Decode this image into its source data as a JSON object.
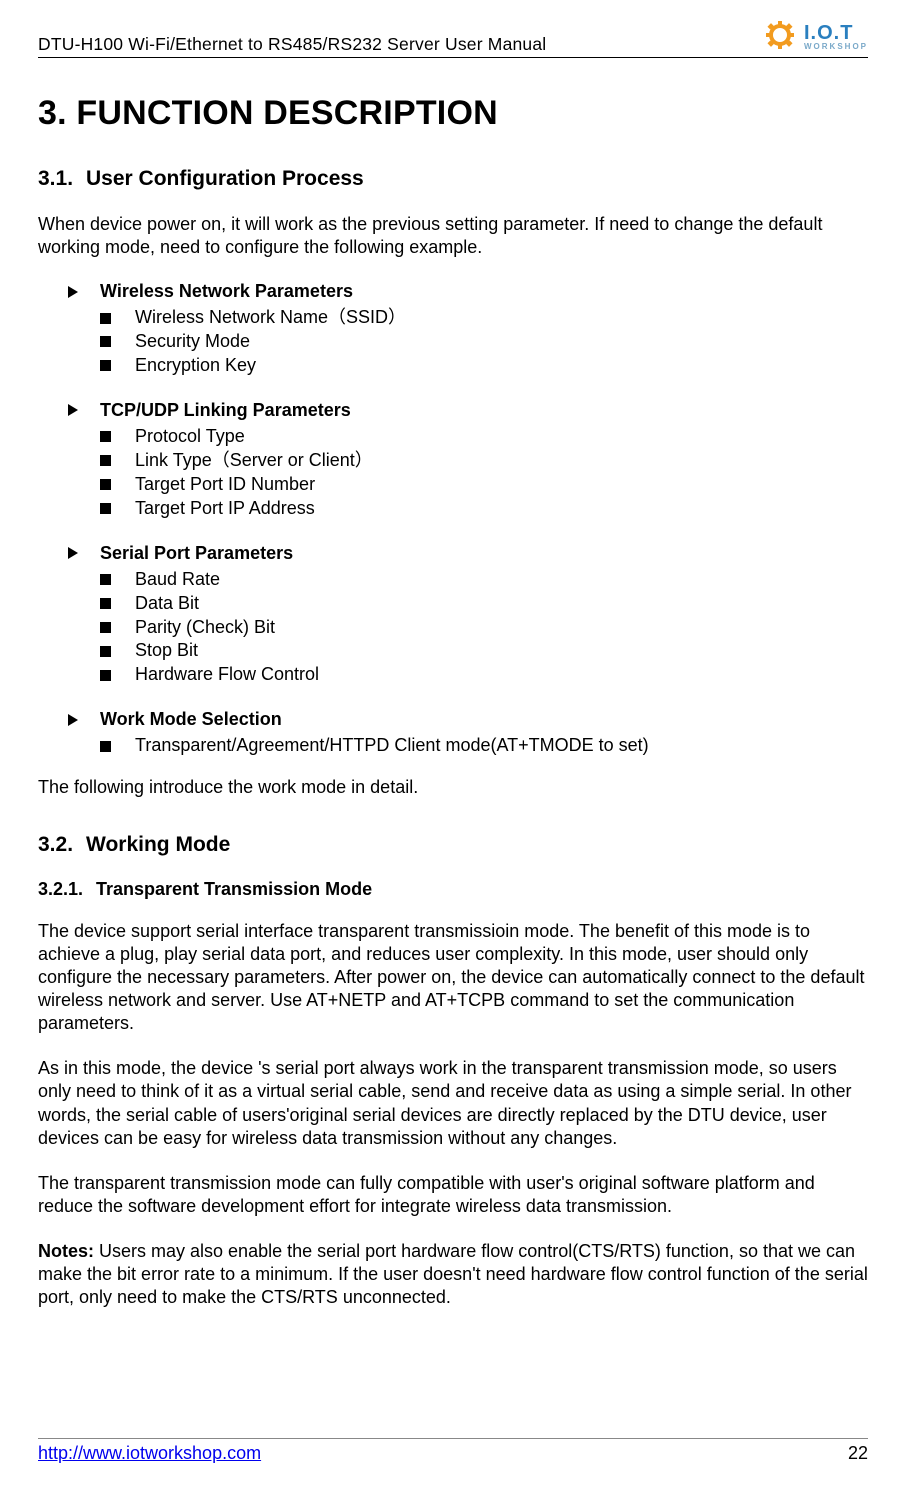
{
  "header": {
    "title": "DTU-H100  Wi-Fi/Ethernet to RS485/RS232  Server User Manual",
    "logo": {
      "top": "I.O.T",
      "sub": "WORKSHOP"
    }
  },
  "h1": "3. FUNCTION DESCRIPTION",
  "s31": {
    "num": "3.1.",
    "title": "User Configuration Process",
    "intro": "When device power on, it will work as the previous setting parameter. If need to change the default working mode, need to configure the following example.",
    "groups": [
      {
        "head": "Wireless Network Parameters",
        "items": [
          "Wireless Network Name（SSID）",
          "Security Mode",
          "Encryption Key"
        ]
      },
      {
        "head": "TCP/UDP Linking Parameters",
        "items": [
          "Protocol Type",
          "Link Type（Server or Client）",
          "Target Port ID Number",
          "Target Port IP Address"
        ]
      },
      {
        "head": "Serial Port Parameters",
        "items": [
          "Baud Rate",
          "Data Bit",
          "Parity (Check) Bit",
          "Stop Bit",
          "Hardware Flow Control"
        ]
      },
      {
        "head": "Work Mode Selection",
        "items": [
          "Transparent/Agreement/HTTPD Client mode(AT+TMODE to set)"
        ]
      }
    ],
    "outro": "The following introduce the work mode in detail."
  },
  "s32": {
    "num": "3.2.",
    "title": "Working Mode",
    "s321": {
      "num": "3.2.1.",
      "title": "Transparent Transmission Mode",
      "p1": "The device support serial interface transparent transmissioin mode. The benefit of this mode is to achieve a plug, play serial data port, and reduces user complexity. In this mode, user should only configure the necessary parameters. After power on, the device can automatically connect to the default wireless network and server. Use AT+NETP and AT+TCPB command to set the communication parameters.",
      "p2": "As in this mode, the device 's serial port always work in the transparent transmission mode, so users only need to think of it as a virtual serial cable, send and receive data as using a simple serial. In other words, the serial cable of users'original serial devices are directly replaced by the DTU device, user devices can be easy for wireless data transmission without any changes.",
      "p3": "The transparent transmission mode can fully compatible with user's original software platform and reduce the software development effort for integrate wireless data transmission.",
      "noteLabel": "Notes:",
      "noteBody": " Users may also enable the serial port hardware flow control(CTS/RTS) function, so that we can make the bit error rate to a minimum. If the user doesn't need hardware flow control function of the serial port, only need to make the CTS/RTS unconnected."
    }
  },
  "footer": {
    "url": "http://www.iotworkshop.com",
    "page": "22"
  }
}
